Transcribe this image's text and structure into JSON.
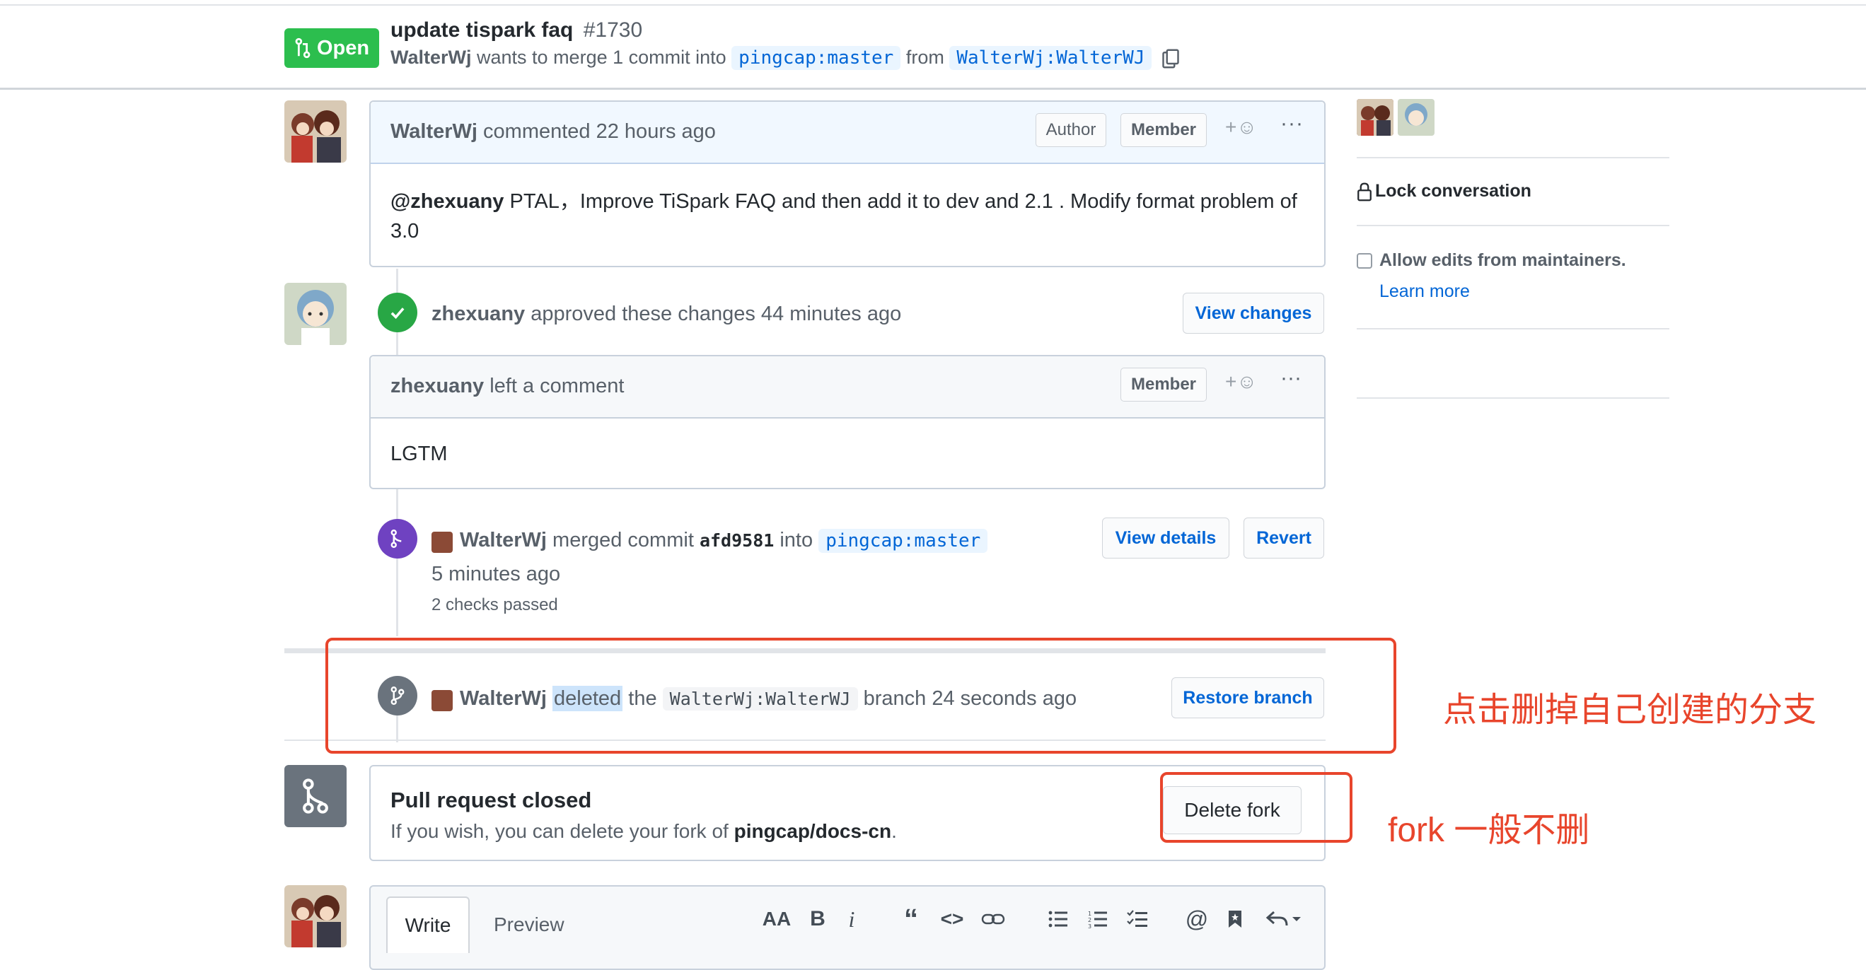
{
  "header": {
    "status": "Open",
    "title": "update tispark faq",
    "number": "#1730",
    "author": "WalterWj",
    "merge_text": "wants to merge 1 commit into",
    "base_branch": "pingcap:master",
    "from_text": "from",
    "head_branch": "WalterWj:WalterWJ"
  },
  "comment1": {
    "author": "WalterWj",
    "action": "commented 22 hours ago",
    "label_author": "Author",
    "label_member": "Member",
    "mention": "@zhexuany",
    "body": " PTAL，Improve TiSpark FAQ and then add it to dev and 2.1 . Modify format problem of 3.0"
  },
  "review": {
    "author": "zhexuany",
    "action": "approved these changes 44 minutes ago",
    "button": "View changes",
    "comment_author": "zhexuany",
    "comment_action": "left a comment",
    "label_member": "Member",
    "body": "LGTM"
  },
  "merge_event": {
    "author": "WalterWj",
    "text": "merged commit",
    "commit": "afd9581",
    "into": "into",
    "branch": "pingcap:master",
    "time": "5 minutes ago",
    "checks": "2 checks passed",
    "view_details": "View details",
    "revert": "Revert"
  },
  "delete_event": {
    "author": "WalterWj",
    "deleted": "deleted",
    "the": "the",
    "branch": "WalterWj:WalterWJ",
    "suffix": "branch 24 seconds ago",
    "button": "Restore branch"
  },
  "closed": {
    "title": "Pull request closed",
    "desc_prefix": "If you wish, you can delete your fork of",
    "repo": "pingcap/docs-cn",
    "desc_suffix": ".",
    "button": "Delete fork"
  },
  "editor": {
    "tab_write": "Write",
    "tab_preview": "Preview",
    "aa": "AA",
    "bold": "B",
    "italic": "i"
  },
  "sidebar": {
    "lock": "Lock conversation",
    "allow_edits": "Allow edits from maintainers.",
    "learn_more": "Learn more"
  },
  "annotations": {
    "delete_branch": "点击删掉自己创建的分支",
    "fork": "fork 一般不删"
  },
  "colors": {
    "open_green": "#2cbe4e",
    "approved_green": "#28a745",
    "merged_purple": "#6f42c1",
    "link_blue": "#0366d6",
    "annotation_red": "#e8452c"
  }
}
